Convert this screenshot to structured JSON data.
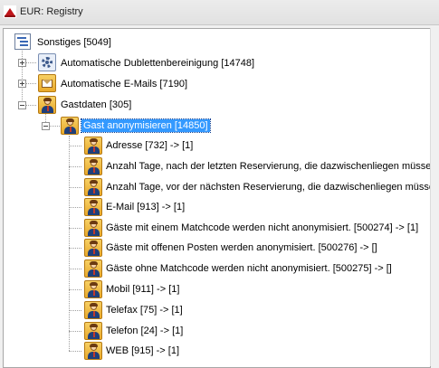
{
  "window": {
    "title": "EUR: Registry"
  },
  "tree": {
    "root": {
      "label": "Sonstiges [5049]",
      "icon": "tree-list-icon"
    },
    "level1": [
      {
        "label": "Automatische Dublettenbereinigung [14748]",
        "icon": "gear-icon",
        "expanded": false
      },
      {
        "label": "Automatische E-Mails [7190]",
        "icon": "mail-icon",
        "expanded": false
      },
      {
        "label": "Gastdaten [305]",
        "icon": "person-icon",
        "expanded": true
      }
    ],
    "selected": {
      "label": "Gast anonymisieren [14850]",
      "icon": "person-icon"
    },
    "children": [
      {
        "label": "Adresse [732]  -> [1]"
      },
      {
        "label": "Anzahl Tage, nach der letzten Reservierung, die dazwischenliegen müssen um einen G"
      },
      {
        "label": "Anzahl Tage, vor der nächsten Reservierung, die dazwischenliegen müssen um einen G"
      },
      {
        "label": "E-Mail [913]  -> [1]"
      },
      {
        "label": "Gäste mit einem Matchcode werden nicht anonymisiert. [500274]  -> [1]"
      },
      {
        "label": "Gäste mit offenen Posten werden anonymisiert. [500276]  -> []"
      },
      {
        "label": "Gäste ohne Matchcode werden nicht anonymisiert. [500275]  -> []"
      },
      {
        "label": "Mobil [911]  -> [1]"
      },
      {
        "label": "Telefax [75]  -> [1]"
      },
      {
        "label": "Telefon [24]  -> [1]"
      },
      {
        "label": "WEB [915]  -> [1]"
      }
    ]
  },
  "colors": {
    "selection": "#3399ff",
    "tree_background": "#ffffff",
    "titlebar": "#e6e6e6"
  }
}
